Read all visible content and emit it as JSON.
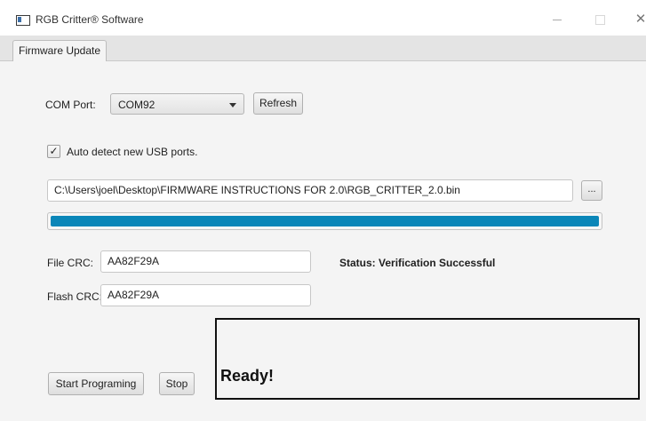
{
  "window": {
    "title": "RGB Critter® Software",
    "icons": [
      "app-icon",
      "minimize-icon",
      "maximize-icon",
      "close-icon"
    ]
  },
  "tabs": [
    {
      "label": "Firmware Update",
      "selected": true
    }
  ],
  "com_port": {
    "label": "COM Port:",
    "selected": "COM92",
    "refresh_label": "Refresh"
  },
  "auto_detect": {
    "label": "Auto detect new USB ports.",
    "checked": true
  },
  "file": {
    "path": "C:\\Users\\joel\\Desktop\\FIRMWARE INSTRUCTIONS FOR 2.0\\RGB_CRITTER_2.0.bin",
    "browse_label": "...",
    "progress": 1.0
  },
  "crc": {
    "file_label": "File CRC:",
    "file_value": "AA82F29A",
    "flash_label": "Flash CRC:",
    "flash_value": "AA82F29A",
    "status": "Status: Verification Successful"
  },
  "actions": {
    "start_label": "Start Programing",
    "stop_label": "Stop"
  },
  "message": {
    "text": "Ready!"
  },
  "colors": {
    "progress": "#0a86b8",
    "message_border": "#111111"
  }
}
